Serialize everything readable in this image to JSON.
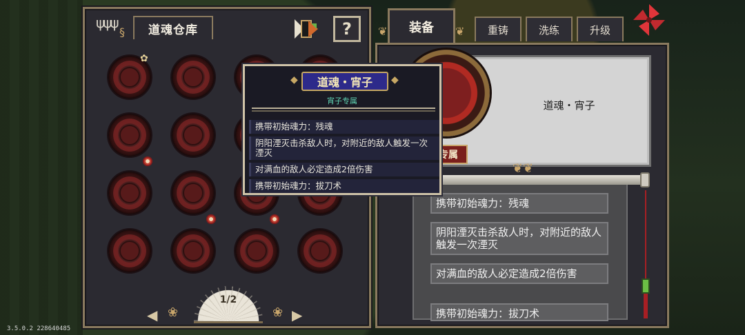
{
  "warehouse": {
    "title": "道魂仓库",
    "help_label": "?",
    "page_indicator": "1/2",
    "prev_label": "◀",
    "next_label": "▶",
    "slots": [
      {
        "id": 1,
        "badge": "star"
      },
      {
        "id": 2,
        "badge": ""
      },
      {
        "id": 3,
        "badge": ""
      },
      {
        "id": 4,
        "badge": ""
      },
      {
        "id": 5,
        "badge": "dot"
      },
      {
        "id": 6,
        "badge": ""
      },
      {
        "id": 7,
        "badge": ""
      },
      {
        "id": 8,
        "badge": ""
      },
      {
        "id": 9,
        "badge": ""
      },
      {
        "id": 10,
        "badge": "dot"
      },
      {
        "id": 11,
        "badge": "dot"
      },
      {
        "id": 12,
        "badge": ""
      },
      {
        "id": 13,
        "badge": ""
      },
      {
        "id": 14,
        "badge": ""
      },
      {
        "id": 15,
        "badge": ""
      },
      {
        "id": 16,
        "badge": ""
      }
    ]
  },
  "tooltip": {
    "title": "道魂・宵子",
    "subtitle": "宵子专属",
    "lines": [
      "携带初始魂力：残魂",
      "阴阳湮灭击杀敌人时，对附近的敌人触发一次湮灭",
      "对满血的敌人必定造成2倍伤害",
      "携带初始魂力：拔刀术"
    ]
  },
  "equipment": {
    "tabs": [
      "装备",
      "重铸",
      "洗练",
      "升级"
    ],
    "active_tab": "装备",
    "item_name": "道魂・宵子",
    "exclusive_badge": "宵子专属",
    "effects": [
      "携带初始魂力：残魂",
      "阴阳湮灭击杀敌人时，对附近的敌人触发一次湮灭",
      "对满血的敌人必定造成2倍伤害",
      "携带初始魂力：拔刀术"
    ]
  },
  "colors": {
    "panel": "#2b2a31",
    "gold_trim": "#8a7a5e",
    "accent_red": "#b02a22",
    "tooltip_title_bg": "#2d2a8a",
    "tooltip_subtitle": "#5fd1b0"
  },
  "icons": [
    "forks-icon",
    "bookmark-icon",
    "help-icon",
    "close-pinwheel-icon",
    "star-icon",
    "fan-icon",
    "tassel-icon"
  ],
  "version": "3.5.0.2 228640485"
}
